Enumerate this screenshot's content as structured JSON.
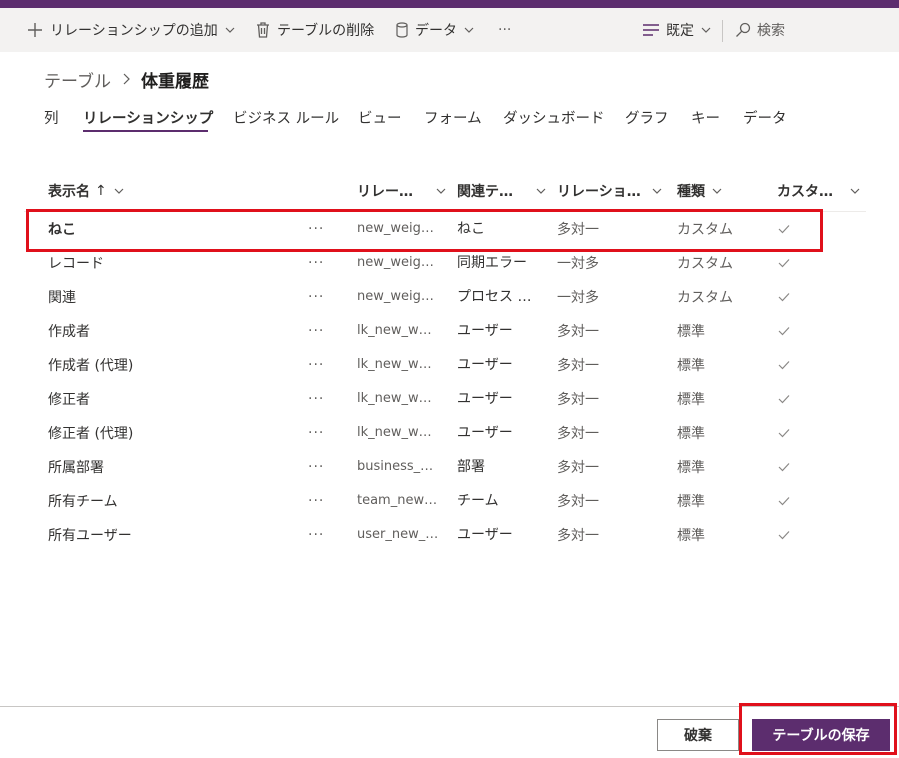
{
  "colors": {
    "brand": "#5c2d6e",
    "highlight": "#e0101b",
    "commandbar_bg": "#f3f2f1"
  },
  "commandbar": {
    "add_relationship": "リレーションシップの追加",
    "delete_table": "テーブルの削除",
    "data": "データ",
    "more": "···",
    "view": "既定",
    "search": "検索"
  },
  "breadcrumb": {
    "root": "テーブル",
    "current": "体重履歴"
  },
  "tabs": [
    "列",
    "リレーションシップ",
    "ビジネス ルール",
    "ビュー",
    "フォーム",
    "ダッシュボード",
    "グラフ",
    "キー",
    "データ"
  ],
  "active_tab": "リレーションシップ",
  "columns": {
    "display_name": "表示名",
    "sort_indicator": "↑",
    "schema": "リレー…",
    "related_table": "関連テ…",
    "relationship_type": "リレーショ…",
    "kind": "種類",
    "custom": "カスタ…"
  },
  "rows": [
    {
      "name": "ねこ",
      "more": "···",
      "schema": "new_weigh…",
      "related": "ねこ",
      "type": "多対一",
      "kind": "カスタム",
      "custom": "✓"
    },
    {
      "name": "レコード",
      "more": "···",
      "schema": "new_weigh…",
      "related": "同期エラー",
      "type": "一対多",
      "kind": "カスタム",
      "custom": "✓"
    },
    {
      "name": "関連",
      "more": "···",
      "schema": "new_weigh…",
      "related": "プロセス …",
      "type": "一対多",
      "kind": "カスタム",
      "custom": "✓"
    },
    {
      "name": "作成者",
      "more": "···",
      "schema": "lk_new_wei…",
      "related": "ユーザー",
      "type": "多対一",
      "kind": "標準",
      "custom": "✓"
    },
    {
      "name": "作成者 (代理)",
      "more": "···",
      "schema": "lk_new_wei…",
      "related": "ユーザー",
      "type": "多対一",
      "kind": "標準",
      "custom": "✓"
    },
    {
      "name": "修正者",
      "more": "···",
      "schema": "lk_new_wei…",
      "related": "ユーザー",
      "type": "多対一",
      "kind": "標準",
      "custom": "✓"
    },
    {
      "name": "修正者 (代理)",
      "more": "···",
      "schema": "lk_new_wei…",
      "related": "ユーザー",
      "type": "多対一",
      "kind": "標準",
      "custom": "✓"
    },
    {
      "name": "所属部署",
      "more": "···",
      "schema": "business_u…",
      "related": "部署",
      "type": "多対一",
      "kind": "標準",
      "custom": "✓"
    },
    {
      "name": "所有チーム",
      "more": "···",
      "schema": "team_new_…",
      "related": "チーム",
      "type": "多対一",
      "kind": "標準",
      "custom": "✓"
    },
    {
      "name": "所有ユーザー",
      "more": "···",
      "schema": "user_new_…",
      "related": "ユーザー",
      "type": "多対一",
      "kind": "標準",
      "custom": "✓"
    }
  ],
  "footer": {
    "discard": "破棄",
    "save": "テーブルの保存"
  }
}
